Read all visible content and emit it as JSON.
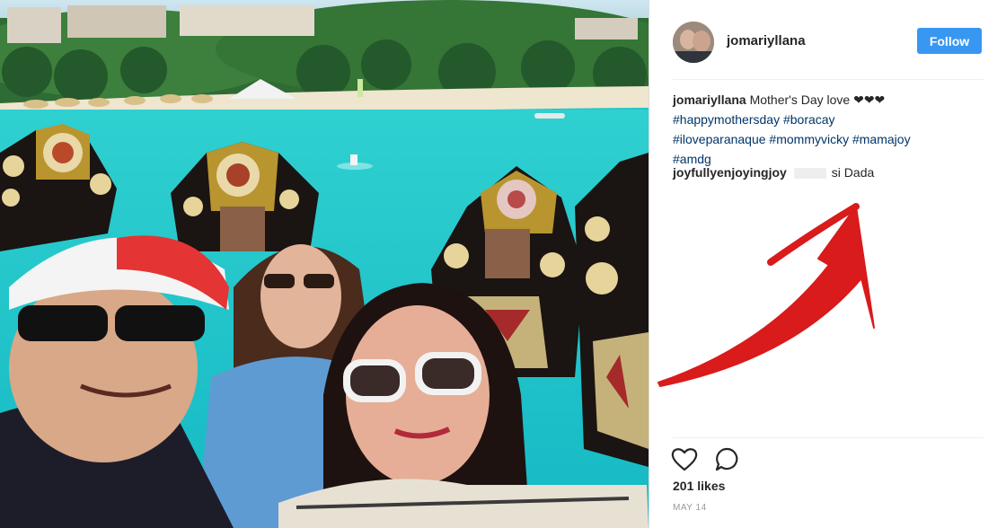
{
  "post": {
    "username": "jomariyllana",
    "follow_label": "Follow",
    "caption": {
      "username": "jomariyllana",
      "text": "Mother's Day love",
      "hearts": "❤❤❤",
      "hashtags": [
        "#happymothersday",
        "#boracay",
        "#iloveparanaque",
        "#mommyvicky",
        "#mamajoy",
        "#amdg"
      ]
    },
    "comment": {
      "username": "joyfullyenjoyingjoy",
      "text": "si Dada"
    },
    "likes": "201 likes",
    "date": "MAY 14",
    "icons": {
      "like": "heart-icon",
      "comment": "speech-bubble-icon"
    },
    "annotation": {
      "arrow_color": "#d91b1b",
      "arrow_icon": "red-arrow"
    }
  },
  "colors": {
    "follow_button": "#3897f0",
    "hashtag": "#003569",
    "text": "#262626"
  }
}
